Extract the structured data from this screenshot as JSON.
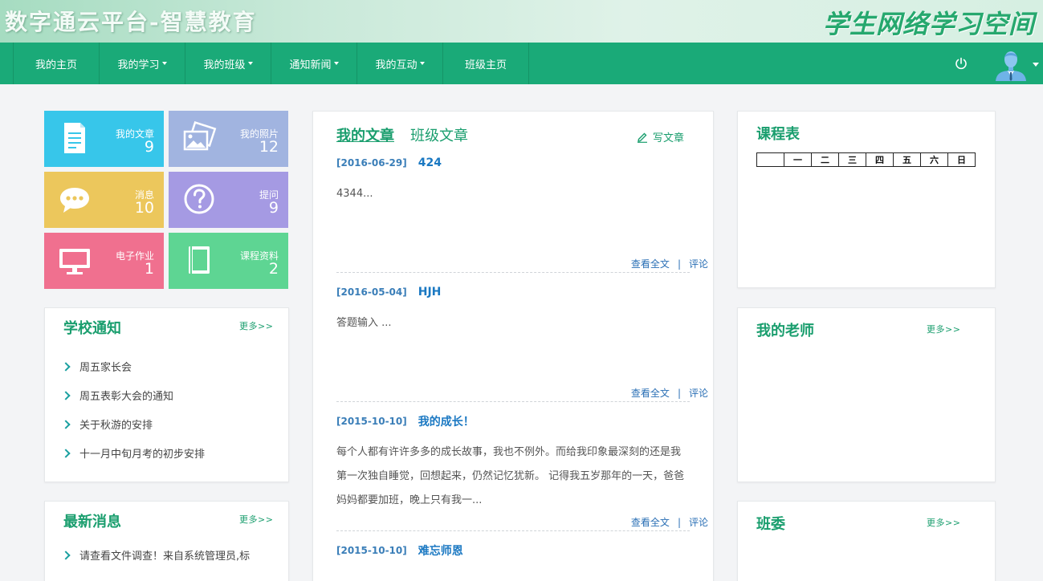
{
  "banner": {
    "title": "数字通云平台-智慧教育",
    "subtitle": "学生网络学习空间"
  },
  "nav": {
    "items": [
      {
        "label": "我的主页",
        "dropdown": false
      },
      {
        "label": "我的学习",
        "dropdown": true
      },
      {
        "label": "我的班级",
        "dropdown": true
      },
      {
        "label": "通知新闻",
        "dropdown": true
      },
      {
        "label": "我的互动",
        "dropdown": true
      },
      {
        "label": "班级主页",
        "dropdown": false
      }
    ],
    "power_icon": "power-icon",
    "avatar_icon": "user-avatar-icon"
  },
  "tiles": [
    {
      "label": "我的文章",
      "count": "9",
      "color": "#37c6ea",
      "icon": "document-icon"
    },
    {
      "label": "我的照片",
      "count": "12",
      "color": "#a1b4e0",
      "icon": "photos-icon"
    },
    {
      "label": "消息",
      "count": "10",
      "color": "#ecc75c",
      "icon": "chat-bubble-icon"
    },
    {
      "label": "提问",
      "count": "9",
      "color": "#a59ae3",
      "icon": "question-icon"
    },
    {
      "label": "电子作业",
      "count": "1",
      "color": "#f0708f",
      "icon": "monitor-icon"
    },
    {
      "label": "课程资料",
      "count": "2",
      "color": "#5ed593",
      "icon": "book-icon"
    }
  ],
  "school_notice": {
    "title": "学校通知",
    "more": "更多>>",
    "items": [
      "周五家长会",
      "周五表彰大会的通知",
      "关于秋游的安排",
      "十一月中旬月考的初步安排"
    ]
  },
  "latest_messages": {
    "title": "最新消息",
    "more": "更多>>",
    "items": [
      "请查看文件调查！来自系统管理员,标"
    ]
  },
  "articles": {
    "tab_mine": "我的文章",
    "tab_class": "班级文章",
    "write_label": "写文章",
    "view_full": "查看全文",
    "separator": "|",
    "comment": "评论",
    "items": [
      {
        "date": "[2016-06-29]",
        "title": "424",
        "body": "4344..."
      },
      {
        "date": "[2016-05-04]",
        "title": "HJH",
        "body": "答题输入 ..."
      },
      {
        "date": "[2015-10-10]",
        "title": "我的成长！",
        "body": "每个人都有许许多多的成长故事，我也不例外。而给我印象最深刻的还是我第一次独自睡觉，回想起来，仍然记忆犹新。 记得我五岁那年的一天，爸爸妈妈都要加班，晚上只有我一..."
      },
      {
        "date": "[2015-10-10]",
        "title": "难忘师恩",
        "body": ""
      }
    ]
  },
  "schedule": {
    "title": "课程表",
    "days": [
      "",
      "一",
      "二",
      "三",
      "四",
      "五",
      "六",
      "日"
    ]
  },
  "teachers": {
    "title": "我的老师",
    "more": "更多>>"
  },
  "committee": {
    "title": "班委",
    "more": "更多>>"
  }
}
